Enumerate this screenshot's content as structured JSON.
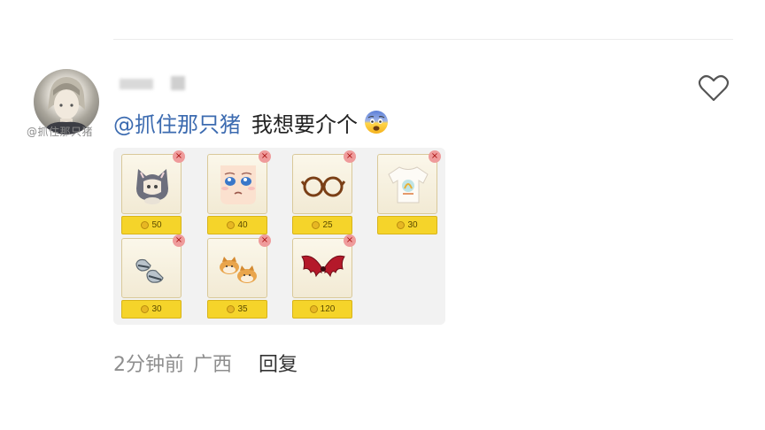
{
  "comment": {
    "watermark": "@抓住那只猪",
    "mention": "@抓住那只猪",
    "text": "我想要介个",
    "emoji_icon": "fearful-face-emoji"
  },
  "items": [
    {
      "price": "50",
      "icon": "cat-hood-hat-icon"
    },
    {
      "price": "40",
      "icon": "crying-face-icon"
    },
    {
      "price": "25",
      "icon": "round-glasses-icon"
    },
    {
      "price": "30",
      "icon": "tshirt-icon"
    },
    {
      "price": "30",
      "icon": "shoes-icon"
    },
    {
      "price": "35",
      "icon": "shiba-slippers-icon"
    },
    {
      "price": "120",
      "icon": "bat-wings-icon"
    }
  ],
  "meta": {
    "time": "2分钟前",
    "location": "广西",
    "reply_label": "回复"
  },
  "colors": {
    "mention": "#3c6bb0",
    "price_bg": "#f5d42a"
  }
}
